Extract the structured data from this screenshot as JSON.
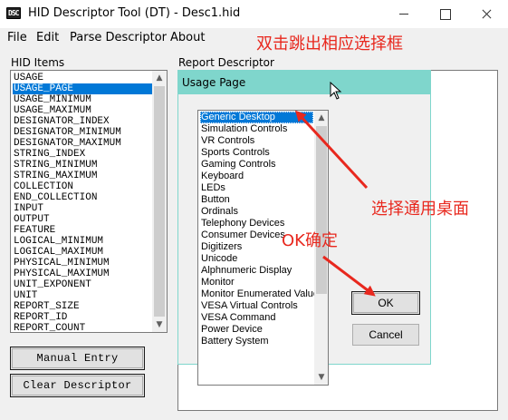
{
  "window": {
    "icon_text": "DSC",
    "title": "HID Descriptor Tool (DT) - Desc1.hid"
  },
  "menu": {
    "items": [
      "File",
      "Edit",
      "Parse Descriptor",
      "About"
    ]
  },
  "annotations": {
    "top": "双击跳出相应选择框",
    "select": "选择通用桌面",
    "ok": "OK确定"
  },
  "hid_items": {
    "label": "HID Items",
    "selected_index": 1,
    "items": [
      "USAGE",
      "USAGE_PAGE",
      "USAGE_MINIMUM",
      "USAGE_MAXIMUM",
      "DESIGNATOR_INDEX",
      "DESIGNATOR_MINIMUM",
      "DESIGNATOR_MAXIMUM",
      "STRING_INDEX",
      "STRING_MINIMUM",
      "STRING_MAXIMUM",
      "COLLECTION",
      "END_COLLECTION",
      "INPUT",
      "OUTPUT",
      "FEATURE",
      "LOGICAL_MINIMUM",
      "LOGICAL_MAXIMUM",
      "PHYSICAL_MINIMUM",
      "PHYSICAL_MAXIMUM",
      "UNIT_EXPONENT",
      "UNIT",
      "REPORT_SIZE",
      "REPORT_ID",
      "REPORT_COUNT"
    ]
  },
  "buttons": {
    "manual_entry": "Manual Entry",
    "clear_descriptor": "Clear Descriptor"
  },
  "report": {
    "label": "Report Descriptor"
  },
  "usage_dialog": {
    "title": "Usage Page",
    "selected_index": 0,
    "items": [
      "Generic Desktop",
      "Simulation Controls",
      "VR Controls",
      "Sports Controls",
      "Gaming Controls",
      "Keyboard",
      "LEDs",
      "Button",
      "Ordinals",
      "Telephony Devices",
      "Consumer Devices",
      "Digitizers",
      "Unicode",
      "Alphnumeric Display",
      "Monitor",
      "Monitor Enumerated Value",
      "VESA Virtual Controls",
      "VESA Command",
      "Power Device",
      "Battery System"
    ],
    "ok_label": "OK",
    "cancel_label": "Cancel"
  },
  "colors": {
    "selection": "#0078d7",
    "dialog_title_bg": "#7fd6cc",
    "annotation": "#e8281e"
  }
}
